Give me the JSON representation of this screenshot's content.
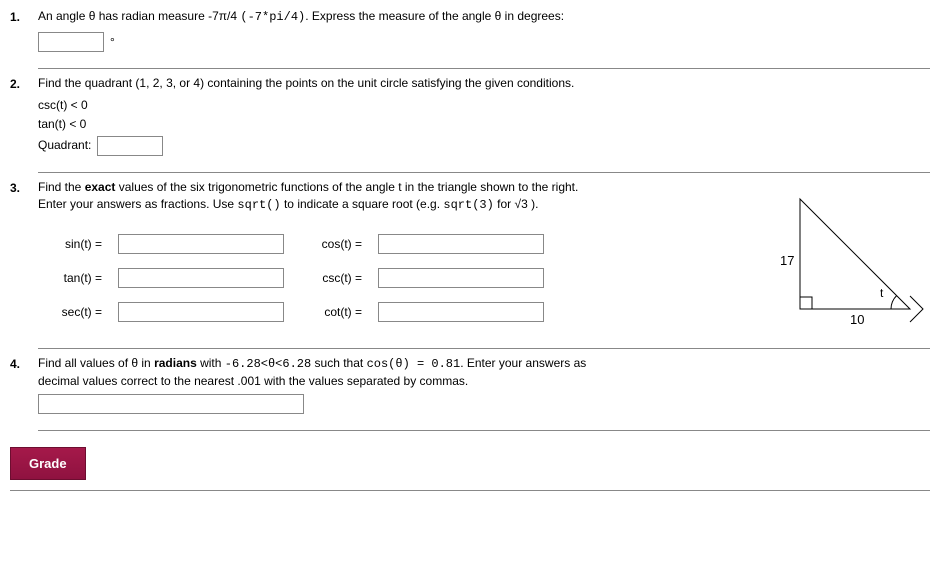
{
  "p1": {
    "num": "1.",
    "text": "An angle θ has radian measure -7π/4 ",
    "code": "(-7*pi/4)",
    "text2": ". Express the measure of the angle θ in degrees:",
    "unit": "°"
  },
  "p2": {
    "num": "2.",
    "text": "Find the quadrant (1, 2, 3, or 4) containing the points on the unit circle satisfying the given conditions.",
    "c1": "csc(t) < 0",
    "c2": "tan(t) < 0",
    "qlabel": "Quadrant:"
  },
  "p3": {
    "num": "3.",
    "line1a": "Find the ",
    "line1b": "exact",
    "line1c": " values of the six trigonometric functions of the angle t in the triangle shown to the right.",
    "line2a": "Enter your answers as fractions. Use ",
    "line2code": "sqrt()",
    "line2b": " to indicate a square root (e.g. ",
    "line2code2": "sqrt(3)",
    "line2c": " for √3 ).",
    "lbl_sin": "sin(t) =",
    "lbl_cos": "cos(t) =",
    "lbl_tan": "tan(t) =",
    "lbl_csc": "csc(t) =",
    "lbl_sec": "sec(t) =",
    "lbl_cot": "cot(t) =",
    "fig_hyp": "17",
    "fig_base": "10",
    "fig_angle": "t"
  },
  "p4": {
    "num": "4.",
    "t1": "Find all values of θ in ",
    "t1b": "radians",
    "t1c": " with ",
    "cond": "-6.28<θ<6.28",
    "t2": " such that ",
    "eq": "cos(θ) = 0.81",
    "t3": ". Enter your answers as",
    "line2": "decimal values correct to the nearest .001 with the values separated by commas."
  },
  "grade": "Grade"
}
